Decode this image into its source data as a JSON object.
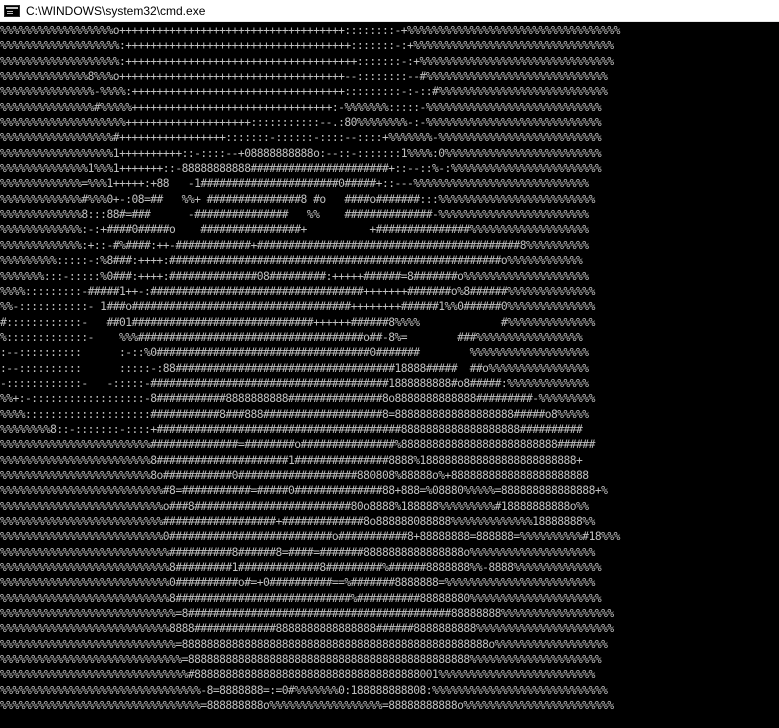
{
  "window": {
    "title": "C:\\WINDOWS\\system32\\cmd.exe",
    "icon": "console-app-icon",
    "background": "#000000",
    "text_color": "#c0c0c0",
    "titlebar_color": "#ffffff"
  },
  "console": {
    "lines": [
      "%%%%%%%%%%%%%%%%%%o++++++++++++++++++++++++++++++++++++::::::::-+%%%%%%%%%%%%%%%%%%%%%%%%%%%%%%%%%%",
      "%%%%%%%%%%%%%%%%%%%:++++++++++++++++++++++++++++++++++++:::::::-:+%%%%%%%%%%%%%%%%%%%%%%%%%%%%%%%%",
      "%%%%%%%%%%%%%%%%%%%:+++++++++++++++++++++++++++++++++++++:::::::-:+%%%%%%%%%%%%%%%%%%%%%%%%%%%%%%%",
      "%%%%%%%%%%%%%%8%%%o++++++++++++++++++++++++++++++++++++--::::::::--#%%%%%%%%%%%%%%%%%%%%%%%%%%%%%",
      "%%%%%%%%%%%%%%%-%%%%:++++++++++++++++++++++++++++++++++:::::::::-:-::#%%%%%%%%%%%%%%%%%%%%%%%%%%%",
      "%%%%%%%%%%%%%%%#%%%%%++++++++++++++++++++++++++++++++:-%%%%%%%:::::-%%%%%%%%%%%%%%%%%%%%%%%%%%%%",
      "%%%%%%%%%%%%%%%%%%%%++++++++++++++++++++:::::::::::--.:80%%%%%%%%-:-%%%%%%%%%%%%%%%%%%%%%%%%%%%%",
      "%%%%%%%%%%%%%%%%%%#+++++++++++++++++:::::::-::::::-::::--::::+%%%%%%%-%%%%%%%%%%%%%%%%%%%%%%%%%%",
      "%%%%%%%%%%%%%%%%%%1++++++++++::-::::--+08888888888o:--::-:::::::1%%%%:0%%%%%%%%%%%%%%%%%%%%%%%%%",
      "%%%%%%%%%%%%%%1%%%1+++++++::-88888888888######################+::--::%-:%%%%%%%%%%%%%%%%%%%%%%%%",
      "%%%%%%%%%%%%%=%%%1+++++:+88   -1######################0#####+::---%%%%%%%%%%%%%%%%%%%%%%%%%%%%",
      "%%%%%%%%%%%%%#%%%0+-:08=##   %%+ ###############8 #o   ####o#######:::%%%%%%%%%%%%%%%%%%%%%%%%%",
      "%%%%%%%%%%%%%8:::88#=###      -###############   %%    ##############-%%%%%%%%%%%%%%%%%%%%%%%%",
      "%%%%%%%%%%%%%:-:+####0#####o    ################+          +###############%%%%%%%%%%%%%%%%%%%",
      "%%%%%%%%%%%%%:+::-#%####:++-############+##########################################8%%%%%%%%%%",
      "%%%%%%%%%:::::-:%8###:++++:#####################################################o%%%%%%%%%%%%",
      "%%%%%%%:::-:::::%0###:++++:##############08#########:+++++######=8#######o%%%%%%%%%%%%%%%%%%%%",
      "%%%%:::::::::-#####1++-:##################################+++++++#######o%8######%%%%%%%%%%%%%%",
      "%%-:::::::::::- 1###o###################################++++++++######1%%0######0%%%%%%%%%%%%%%",
      "#::::::::::::-   ##01#############################++++++######8%%%%             #%%%%%%%%%%%%%%",
      "%:::::::::::::-    %%%####################################o##-8%=        ###%%%%%%%%%%%%%%%%%",
      ":--::::::::::      :-::%0##################################0#######        %%%%%%%%%%%%%%%%%%%",
      ":--::::::::::      :::::-:88###################################18888#####  ##o%%%%%%%%%%%%%%%%",
      "-::::::::::::-   -:::::-######################################1888888888#o8#####:%%%%%%%%%%%%%",
      "%%+:-::::::::::::::::::-8###########8888888888###############8o8888888888888#########-%%%%%%%%%",
      "%%%%::::::::::::::::::::###########8###888###################8=8888888888888888888#####o8%%%%%",
      "%%%%%%%%8::-:::::::-::::+#######################################8888888888888888888##########",
      "%%%%%%%%%%%%%%%%%%%%%%%%##############=########o###############%8888888888888888888888888######",
      "%%%%%%%%%%%%%%%%%%%%%%%%8#####################1###############8888%1888888888888888888888888+",
      "%%%%%%%%%%%%%%%%%%%%%%%%8o###########0###################880808%88888o%+8888888888888888888888",
      "%%%%%%%%%%%%%%%%%%%%%%%%%%#8=###########=#####0##############88+888=%08880%%%%%=888888888888888+%",
      "%%%%%%%%%%%%%%%%%%%%%%%%%%o###8#########################80o8888%188888%%%%%%%%%#18888888888o%%",
      "%%%%%%%%%%%%%%%%%%%%%%%%%%##################+#############8o888888088888%%%%%%%%%%%%%18888888%%",
      "%%%%%%%%%%%%%%%%%%%%%%%%%%0##########################o###########8+88888888=888888=%%%%%%%%%%#18%%%",
      "%%%%%%%%%%%%%%%%%%%%%%%%%%%##########8######8=####=#######8888888888888888o%%%%%%%%%%%%%%%%%%%%",
      "%%%%%%%%%%%%%%%%%%%%%%%%%%%8#########1#############8#########%######8888888%%-8888%%%%%%%%%%%%%%",
      "%%%%%%%%%%%%%%%%%%%%%%%%%%%0##########o#=+0##########==%#######8888888=%%%%%%%%%%%%%%%%%%%%%%%%",
      "%%%%%%%%%%%%%%%%%%%%%%%%%%%8############################%##########88888880%%%%%%%%%%%%%%%%%%%%%",
      "%%%%%%%%%%%%%%%%%%%%%%%%%%%%=8##########################################88888888%%%%%%%%%%%%%%%%%%",
      "%%%%%%%%%%%%%%%%%%%%%%%%%%%8888#############8888888888888888######8888888888%%%%%%%%%%%%%%%%%%%%%%",
      "%%%%%%%%%%%%%%%%%%%%%%%%%%%%=8888888888888888888888888888888888888888888888888o%%%%%%%%%%%%%%%%%%",
      "%%%%%%%%%%%%%%%%%%%%%%%%%%%%%=888888888888888888888888888888888888888888888%%%%%%%%%%%%%%%%%%%%%",
      "%%%%%%%%%%%%%%%%%%%%%%%%%%%%%%#888888888888888888888888888888888888001%%%%%%%%%%%%%%%%%%%%%%%%%",
      "%%%%%%%%%%%%%%%%%%%%%%%%%%%%%%%%-8=8888888=:=0#%%%%%%%0:188888888808:%%%%%%%%%%%%%%%%%%%%%%%%%%%%",
      "%%%%%%%%%%%%%%%%%%%%%%%%%%%%%%%%=888888888o%%%%%%%%%%%%%%%%%%=88888888888o%%%%%%%%%%%%%%%%%%%%%%%%"
    ]
  }
}
